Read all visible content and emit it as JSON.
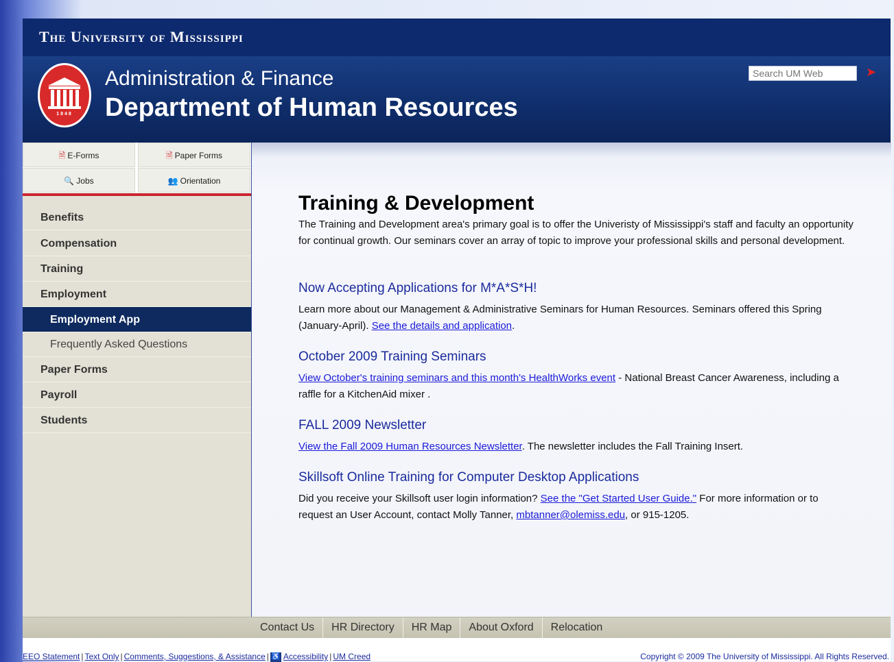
{
  "header": {
    "university": "The University of Mississippi",
    "admin_title": "Administration & Finance",
    "dept_title": "Department of Human Resources",
    "seal_year": "1848",
    "search_placeholder": "Search UM Web"
  },
  "quick_links": [
    {
      "label": "E-Forms",
      "icon": "document-icon"
    },
    {
      "label": "Paper Forms",
      "icon": "document-icon"
    },
    {
      "label": "Jobs",
      "icon": "search-icon"
    },
    {
      "label": "Orientation",
      "icon": "people-icon"
    }
  ],
  "sidebar": {
    "items": [
      {
        "label": "Benefits"
      },
      {
        "label": "Compensation"
      },
      {
        "label": "Training"
      },
      {
        "label": "Employment"
      },
      {
        "label": "Employment App"
      },
      {
        "label": "Frequently Asked Questions"
      },
      {
        "label": "Paper Forms"
      },
      {
        "label": "Payroll"
      },
      {
        "label": "Students"
      }
    ]
  },
  "main": {
    "title": "Training & Development",
    "intro": "The Training and Development area's primary goal is to offer the Univeristy of Mississippi's staff and faculty an opportunity for continual growth. Our seminars cover an array of topic to improve your professional skills and personal development.",
    "sections": [
      {
        "title": "Now Accepting Applications for M*A*S*H!",
        "text_before": "Learn more about our Management & Administrative Seminars for Human Resources. Seminars offered this Spring (January-April). ",
        "link": "See the details and application",
        "text_after": "."
      },
      {
        "title": "October 2009 Training Seminars",
        "text_before": "",
        "link": "View October's training seminars and this month's HealthWorks event",
        "text_after": " - National Breast Cancer Awareness, including a raffle for a KitchenAid mixer ."
      },
      {
        "title": "FALL 2009 Newsletter",
        "text_before": "",
        "link": "View the Fall 2009 Human Resources Newsletter",
        "text_after": ". The newsletter includes the Fall Training Insert."
      },
      {
        "title": "Skillsoft Online Training for Computer Desktop Applications",
        "text_before": "Did you receive your Skillsoft user login information? ",
        "link": "See the \"Get Started User Guide.\"",
        "text_middle": " For more information or to request an User Account, contact Molly Tanner, ",
        "link2": "mbtanner@olemiss.edu",
        "text_after": ", or 915-1205."
      }
    ]
  },
  "footer": {
    "links": [
      "Contact Us",
      "HR Directory",
      "HR Map",
      "About Oxford",
      "Relocation"
    ],
    "bottom_links": [
      "EEO Statement",
      "Text Only",
      "Comments, Suggestions, & Assistance",
      "Accessibility",
      "UM Creed"
    ],
    "copyright": "Copyright © 2009 The University of Mississippi. All Rights Reserved."
  },
  "colors": {
    "navy": "#0e2a6e",
    "red": "#c8262c",
    "sidebar_bg": "#e3e1d5",
    "link": "#1a1ad8"
  }
}
